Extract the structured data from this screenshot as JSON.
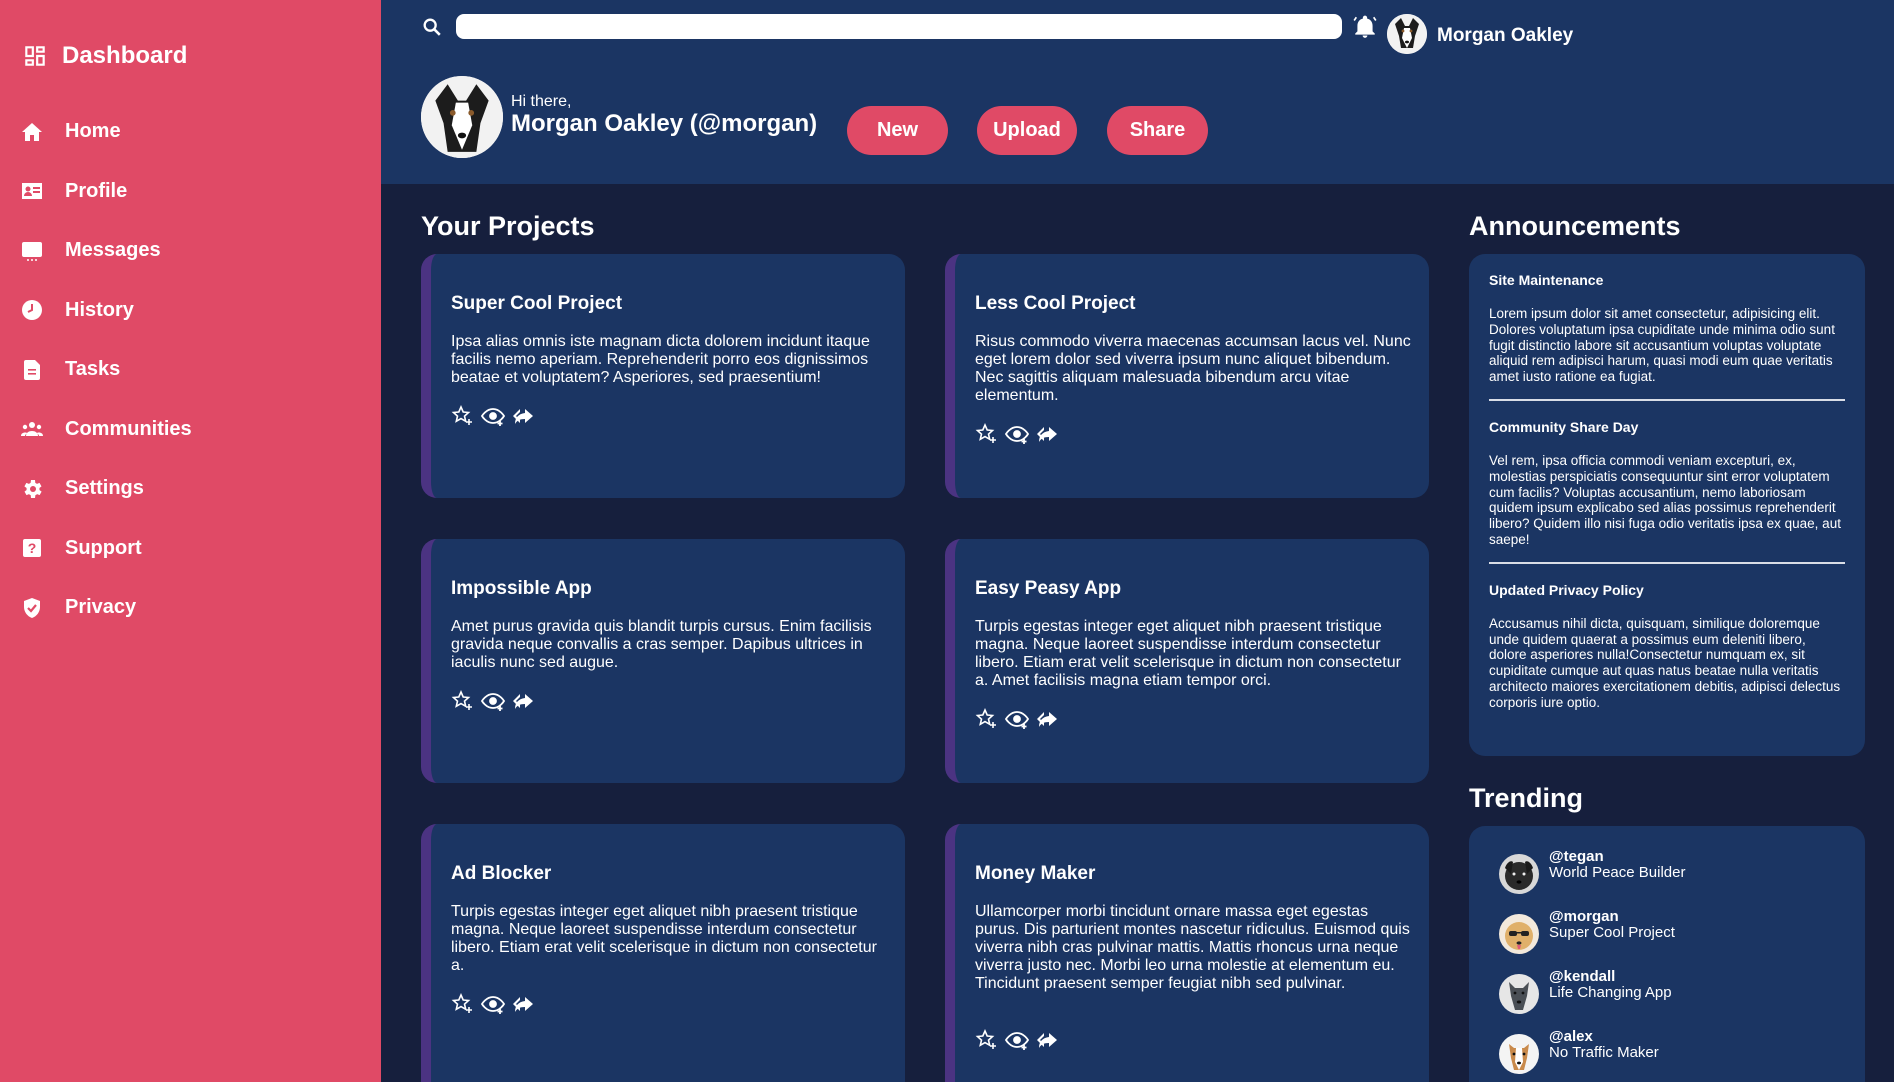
{
  "sidebar": {
    "brand": "Dashboard",
    "items": [
      {
        "label": "Home",
        "icon": "home-icon"
      },
      {
        "label": "Profile",
        "icon": "id-card-icon"
      },
      {
        "label": "Messages",
        "icon": "chat-icon"
      },
      {
        "label": "History",
        "icon": "clock-icon"
      },
      {
        "label": "Tasks",
        "icon": "file-icon"
      },
      {
        "label": "Communities",
        "icon": "people-icon"
      },
      {
        "label": "Settings",
        "icon": "gear-icon"
      },
      {
        "label": "Support",
        "icon": "question-icon"
      },
      {
        "label": "Privacy",
        "icon": "shield-icon"
      }
    ]
  },
  "header": {
    "search_placeholder": "",
    "user_name": "Morgan Oakley",
    "greeting": "Hi there,",
    "full_name": "Morgan Oakley (@morgan)",
    "buttons": {
      "new": "New",
      "upload": "Upload",
      "share": "Share"
    }
  },
  "projects": {
    "title": "Your Projects",
    "items": [
      {
        "title": "Super Cool Project",
        "body": "Ipsa alias omnis iste magnam dicta dolorem incidunt itaque facilis nemo aperiam. Reprehenderit porro eos dignissimos beatae et voluptatem? Asperiores, sed praesentium!"
      },
      {
        "title": "Less Cool Project",
        "body": "Risus commodo viverra maecenas accumsan lacus vel. Nunc eget lorem dolor sed viverra ipsum nunc aliquet bibendum. Nec sagittis aliquam malesuada bibendum arcu vitae elementum."
      },
      {
        "title": "Impossible App",
        "body": "Amet purus gravida quis blandit turpis cursus. Enim facilisis gravida neque convallis a cras semper. Dapibus ultrices in iaculis nunc sed augue."
      },
      {
        "title": "Easy Peasy App",
        "body": "Turpis egestas integer eget aliquet nibh praesent tristique magna. Neque laoreet suspendisse interdum consectetur libero. Etiam erat velit scelerisque in dictum non consectetur a. Amet facilisis magna etiam tempor orci."
      },
      {
        "title": "Ad Blocker",
        "body": "Turpis egestas integer eget aliquet nibh praesent tristique magna. Neque laoreet suspendisse interdum consectetur libero. Etiam erat velit scelerisque in dictum non consectetur a."
      },
      {
        "title": "Money Maker",
        "body": "Ullamcorper morbi tincidunt ornare massa eget egestas purus. Dis parturient montes nascetur ridiculus. Euismod quis viverra nibh cras pulvinar mattis. Mattis rhoncus urna neque viverra justo nec. Morbi leo urna molestie at elementum eu. Tincidunt praesent semper feugiat nibh sed pulvinar."
      }
    ]
  },
  "announcements": {
    "title": "Announcements",
    "items": [
      {
        "title": "Site Maintenance",
        "body": "Lorem ipsum dolor sit amet consectetur, adipisicing elit. Dolores voluptatum ipsa cupiditate unde minima odio sunt fugit distinctio labore sit accusantium voluptas voluptate aliquid rem adipisci harum, quasi modi eum quae veritatis amet iusto ratione ea fugiat."
      },
      {
        "title": "Community Share Day",
        "body": "Vel rem, ipsa officia commodi veniam excepturi, ex, molestias perspiciatis consequuntur sint error voluptatem cum facilis? Voluptas accusantium, nemo laboriosam quidem ipsum explicabo sed alias possimus reprehenderit libero? Quidem illo nisi fuga odio veritatis ipsa ex quae, aut saepe!"
      },
      {
        "title": "Updated Privacy Policy",
        "body": "Accusamus nihil dicta, quisquam, similique doloremque unde quidem quaerat a possimus eum deleniti libero, dolore asperiores nulla!Consectetur numquam ex, sit cupiditate cumque aut quas natus beatae nulla veritatis architecto maiores exercitationem debitis, adipisci delectus corporis iure optio."
      }
    ]
  },
  "trending": {
    "title": "Trending",
    "items": [
      {
        "handle": "@tegan",
        "desc": "World Peace Builder"
      },
      {
        "handle": "@morgan",
        "desc": "Super Cool Project"
      },
      {
        "handle": "@kendall",
        "desc": "Life Changing App"
      },
      {
        "handle": "@alex",
        "desc": "No Traffic Maker"
      }
    ]
  },
  "colors": {
    "sidebar": "#e04a66",
    "header": "#1b3563",
    "background": "#161f3d",
    "card": "#1b3563",
    "card_accent": "#4b3382",
    "button": "#e04a66"
  }
}
